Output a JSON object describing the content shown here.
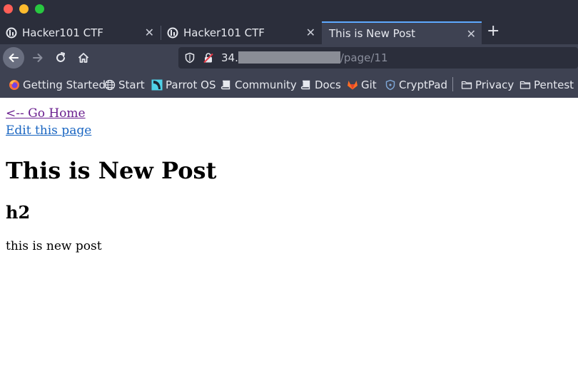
{
  "browser": {
    "tabs": [
      {
        "title": "Hacker101 CTF",
        "icon": "hacker101-icon"
      },
      {
        "title": "Hacker101 CTF",
        "icon": "hacker101-icon"
      },
      {
        "title": "This is New Post",
        "icon": ""
      }
    ],
    "url": {
      "prefix": "34.",
      "path": "/page/11"
    },
    "bookmarks": [
      {
        "label": "Getting Started",
        "icon": "firefox-icon"
      },
      {
        "label": "Start",
        "icon": "globe-icon"
      },
      {
        "label": "Parrot OS",
        "icon": "parrot-icon"
      },
      {
        "label": "Community",
        "icon": "book-icon"
      },
      {
        "label": "Docs",
        "icon": "book-icon"
      },
      {
        "label": "Git",
        "icon": "gitlab-icon"
      },
      {
        "label": "CryptPad",
        "icon": "shield-icon"
      },
      {
        "label": "Privacy",
        "icon": "folder-icon"
      },
      {
        "label": "Pentest",
        "icon": "folder-icon"
      }
    ]
  },
  "page": {
    "go_home_link": "<-- Go Home",
    "edit_link": "Edit this page",
    "title": "This is New Post",
    "subtitle": "h2",
    "body": "this is new post"
  },
  "colors": {
    "chrome_bg": "#2b2e3b",
    "toolbar_bg": "#3e4252",
    "active_tab_accent": "#5ea9ff",
    "visited_link": "#6a1f8f",
    "link": "#1a66c2"
  }
}
